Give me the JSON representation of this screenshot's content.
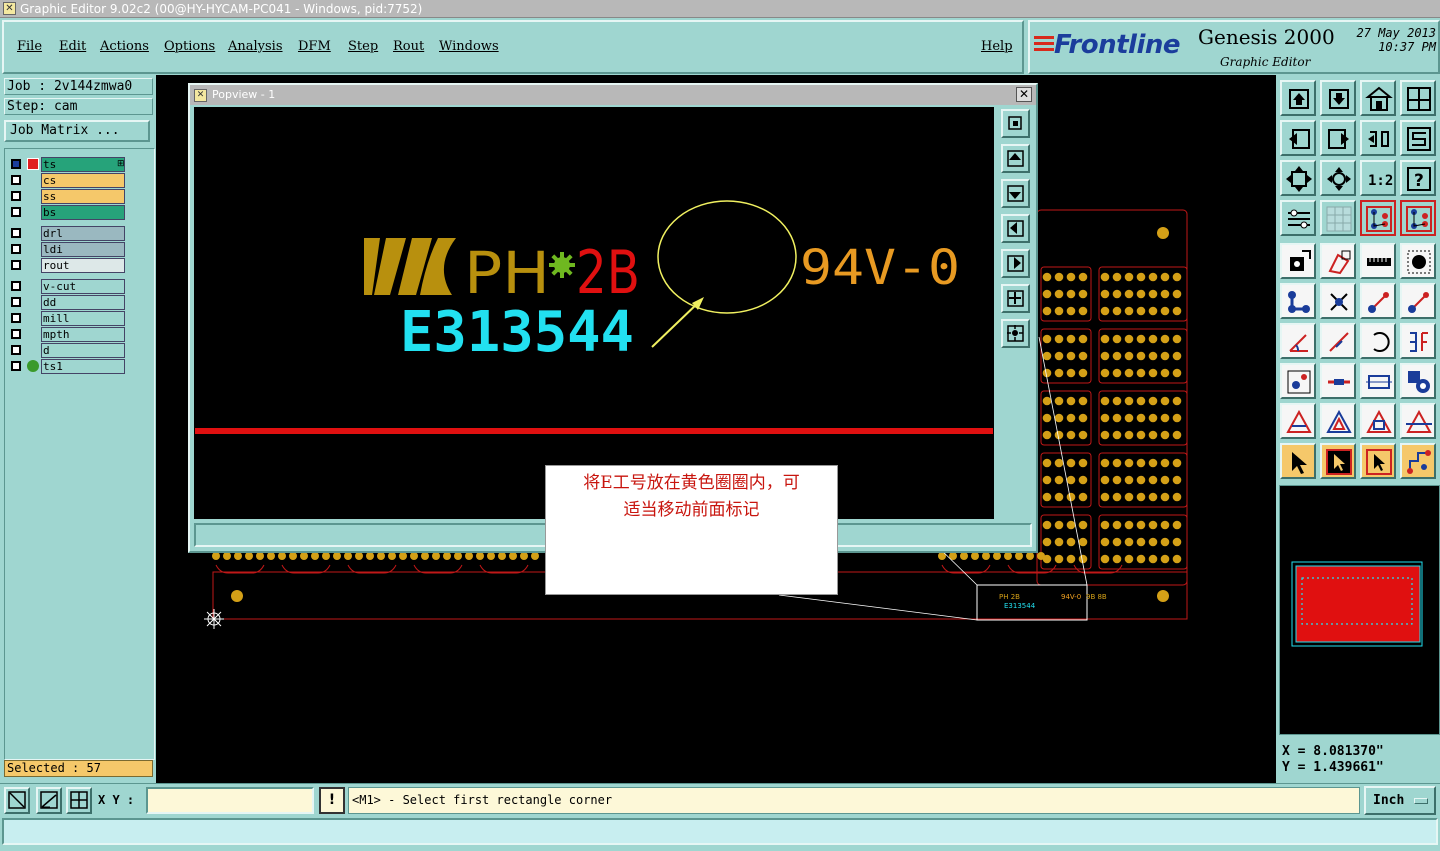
{
  "window": {
    "title": "Graphic Editor 9.02c2 (00@HY-HYCAM-PC041 - Windows, pid:7752)"
  },
  "menu": {
    "items": [
      "File",
      "Edit",
      "Actions",
      "Options",
      "Analysis",
      "DFM",
      "Step",
      "Rout",
      "Windows"
    ],
    "help": "Help"
  },
  "brand": {
    "logo": "Frontline",
    "product": "Genesis 2000",
    "subtitle": "Graphic Editor",
    "date": "27 May 2013",
    "time": "10:37 PM"
  },
  "job": {
    "job": "Job : 2v144zmwa0",
    "step": "Step: cam",
    "matrix": "Job Matrix ..."
  },
  "layers": [
    {
      "name": "ts",
      "color": "#26a37a"
    },
    {
      "name": "cs",
      "color": "#f5c86a"
    },
    {
      "name": "ss",
      "color": "#f5c86a"
    },
    {
      "name": "bs",
      "color": "#26a37a"
    },
    {
      "name": "drl",
      "color": "#9ab8c0"
    },
    {
      "name": "ldi",
      "color": "#9ab8c0"
    },
    {
      "name": "rout",
      "color": "#dde8e8"
    },
    {
      "name": "v-cut",
      "color": "#9fd6d0"
    },
    {
      "name": "dd",
      "color": "#9fd6d0"
    },
    {
      "name": "mill",
      "color": "#9fd6d0"
    },
    {
      "name": "mpth",
      "color": "#9fd6d0"
    },
    {
      "name": "d",
      "color": "#9fd6d0"
    },
    {
      "name": "ts1",
      "color": "#9fd6d0"
    }
  ],
  "selected": "Selected : 57",
  "popview": {
    "title": "Popview - 1",
    "marking_text": "PH",
    "marking_code": "2B",
    "ul_mark": "94V-0",
    "e_number": "E313544"
  },
  "board": {
    "mini_marking": "PH 2B",
    "mini_ul": "94V-0",
    "mini_code": "9B 8B",
    "mini_e": "E313544"
  },
  "annotation": {
    "line1": "将E工号放在黄色圈圈内，可",
    "line2": "适当移动前面标记"
  },
  "coords": {
    "x": "X = 8.081370\"",
    "y": "Y = 1.439661\""
  },
  "bottom": {
    "xy_label": "X Y :",
    "xy_value": "",
    "prompt": "<M1> - Select first rectangle corner",
    "unit": "Inch",
    "warn": "!"
  },
  "toolbox": {
    "ratio_label": "1:2"
  },
  "colors": {
    "panel": "#9fd6d0",
    "gold": "#d4a017",
    "cyan": "#22e0f0",
    "red": "#e01010",
    "orange": "#f0a020"
  }
}
